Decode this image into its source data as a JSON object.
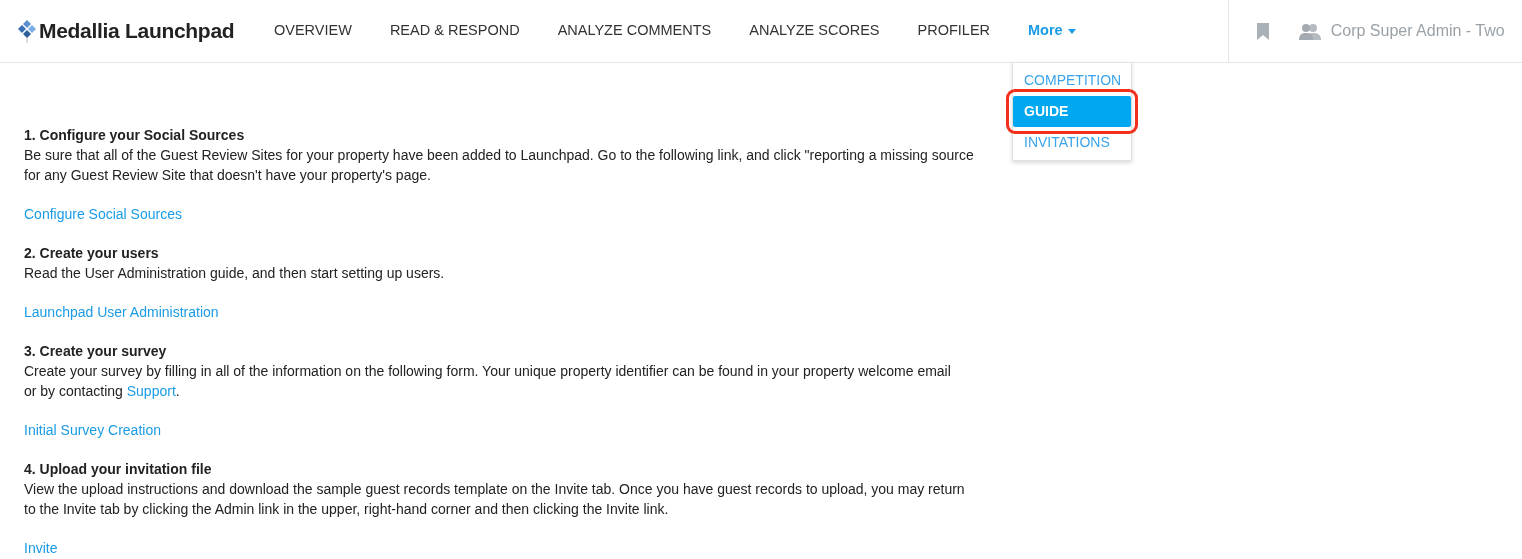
{
  "header": {
    "logo": "Medallia Launchpad",
    "nav": [
      {
        "label": "OVERVIEW",
        "selected": false
      },
      {
        "label": "READ & RESPOND",
        "selected": false
      },
      {
        "label": "ANALYZE COMMENTS",
        "selected": false
      },
      {
        "label": "ANALYZE SCORES",
        "selected": false
      },
      {
        "label": "PROFILER",
        "selected": false
      },
      {
        "label": "More",
        "selected": true,
        "kind": "dropdown"
      }
    ],
    "user": "Corp Super Admin - Two"
  },
  "dropdown": {
    "items": [
      {
        "label": "COMPETITION",
        "selected": false
      },
      {
        "label": "GUIDE",
        "selected": true
      },
      {
        "label": "INVITATIONS",
        "selected": false
      }
    ]
  },
  "sections": [
    {
      "title": "1. Configure your Social Sources",
      "body": [
        {
          "kind": "text",
          "text": "Be sure that all of the Guest Review Sites for your property have been added to Launchpad. Go to the following link, and click \"reporting a missing source"
        },
        {
          "kind": "break"
        },
        {
          "kind": "text",
          "text": "for any Guest Review Site that doesn't have your property's page."
        }
      ],
      "link": "Configure Social Sources"
    },
    {
      "title": "2. Create your users",
      "body": [
        {
          "kind": "text",
          "text": "Read the User Administration guide, and then start setting up users."
        }
      ],
      "link": "Launchpad User Administration"
    },
    {
      "title": "3. Create your survey",
      "body": [
        {
          "kind": "text",
          "text": "Create your survey by filling in all of the information on the following form. Your unique property identifier can be found in your property welcome email"
        },
        {
          "kind": "break"
        },
        {
          "kind": "text",
          "text": "or by contacting "
        },
        {
          "kind": "link",
          "text": "Support"
        },
        {
          "kind": "text",
          "text": "."
        }
      ],
      "link": "Initial Survey Creation"
    },
    {
      "title": "4. Upload your invitation file",
      "body": [
        {
          "kind": "text",
          "text": "View the upload instructions and download the sample guest records template on the Invite tab. Once you have guest records to upload, you may return"
        },
        {
          "kind": "break"
        },
        {
          "kind": "text",
          "text": "to the Invite tab by clicking the Admin link in the upper, right-hand corner and then clicking the Invite link."
        }
      ],
      "link": "Invite"
    }
  ]
}
